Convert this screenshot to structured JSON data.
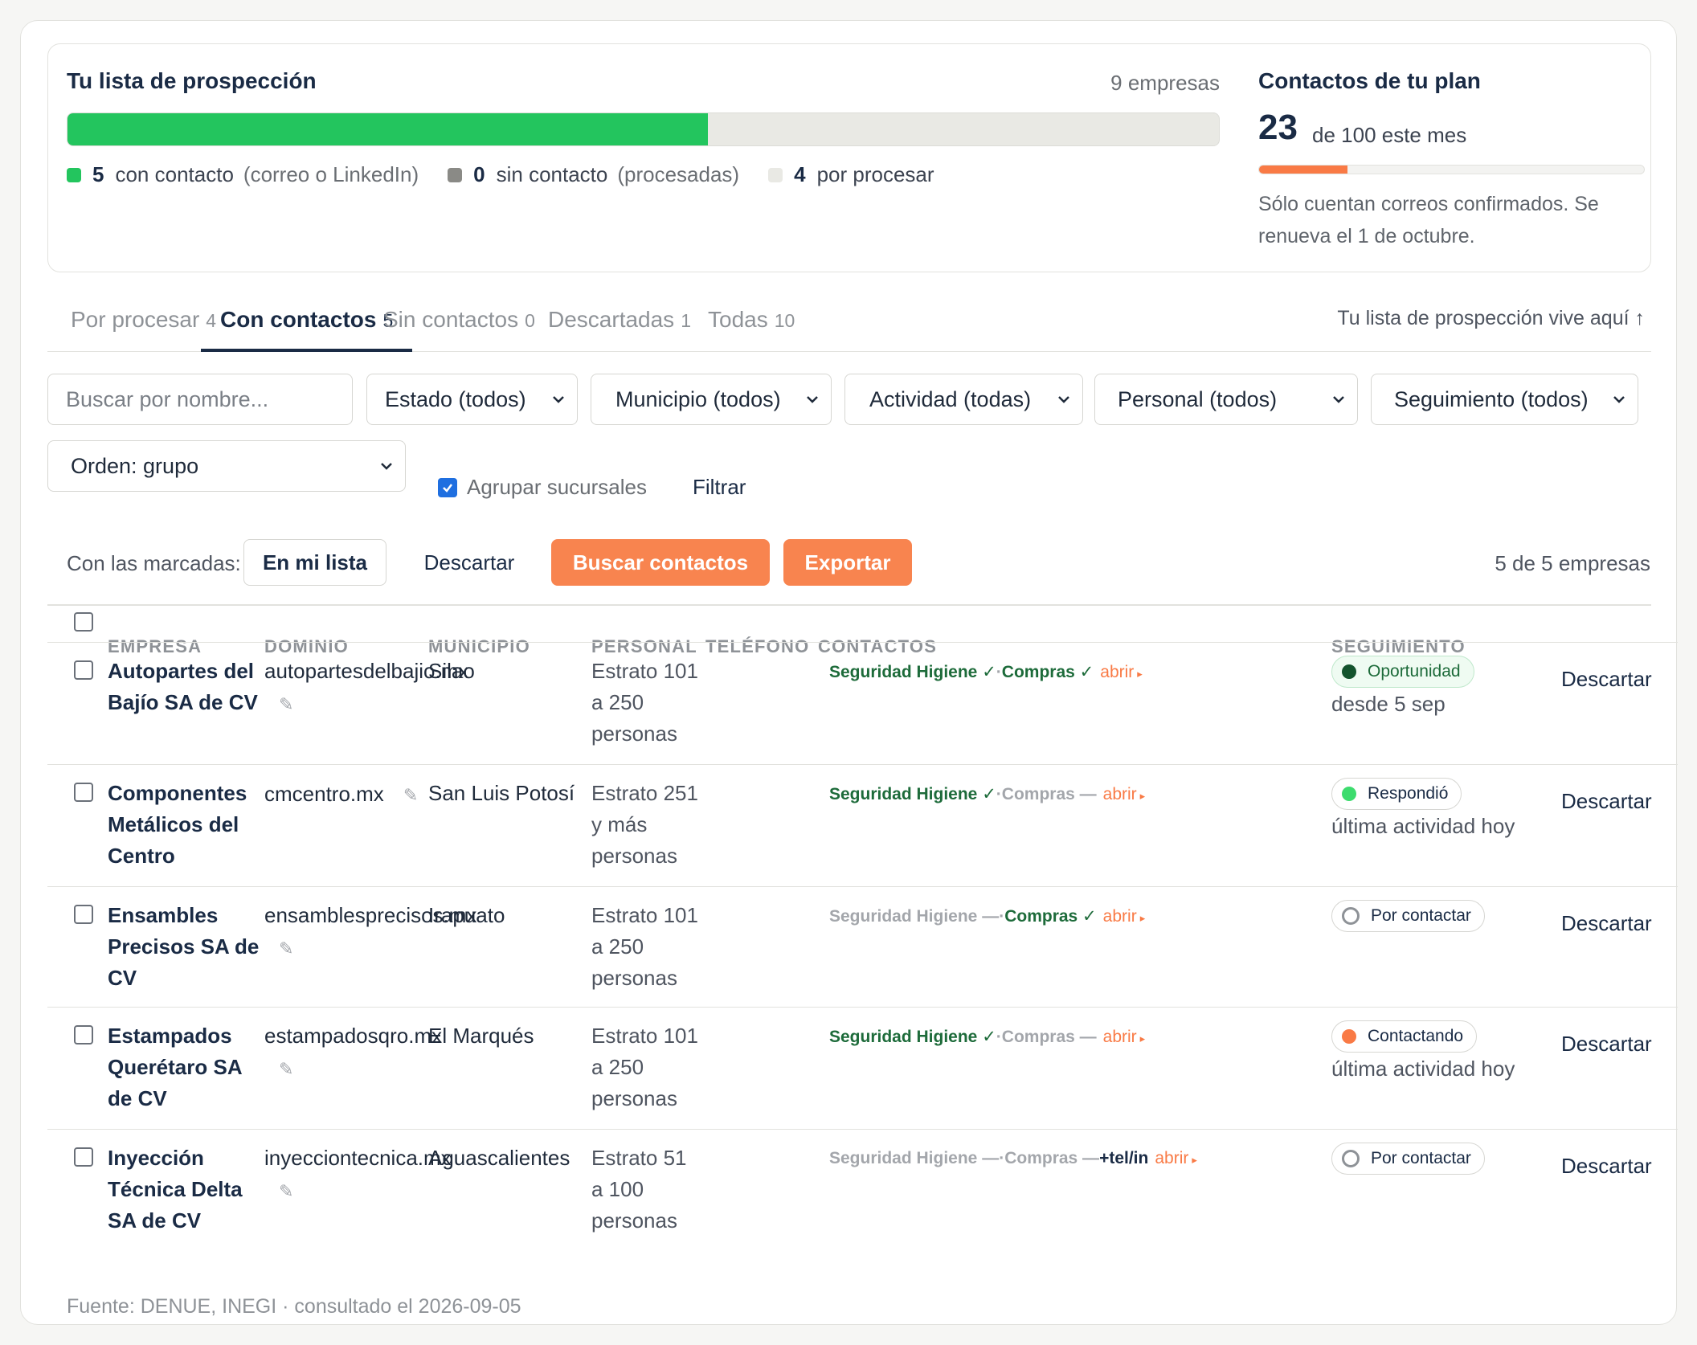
{
  "summary": {
    "title": "Tu lista de prospección",
    "company_count": "9 empresas",
    "progress_fraction": 0.556,
    "legend": [
      {
        "count": "5",
        "label": "con contacto",
        "note": "(correo o LinkedIn)",
        "color": "#23c55e"
      },
      {
        "count": "0",
        "label": "sin contacto",
        "note": "(procesadas)",
        "color": "#8a8a86"
      },
      {
        "count": "4",
        "label": "por procesar",
        "note": "",
        "color": "#e9e9e4"
      }
    ]
  },
  "plan": {
    "title": "Contactos de tu plan",
    "used": "23",
    "of_text": "de 100 este mes",
    "used_fraction": 0.23,
    "note": "Sólo cuentan correos confirmados. Se renueva el 1 de octubre."
  },
  "tabs": [
    {
      "label": "Por procesar",
      "count": "4"
    },
    {
      "label": "Con contactos",
      "count": "5"
    },
    {
      "label": "Sin contactos",
      "count": "0"
    },
    {
      "label": "Descartadas",
      "count": "1"
    },
    {
      "label": "Todas",
      "count": "10"
    }
  ],
  "tab_hint": "Tu lista de prospección vive aquí ↑",
  "filters": {
    "search_placeholder": "Buscar por nombre...",
    "estado": "Estado (todos)",
    "municipio": "Municipio (todos)",
    "actividad": "Actividad (todas)",
    "personal": "Personal (todos)",
    "seguimiento": "Seguimiento (todos)",
    "orden": "Orden: grupo",
    "agrupar_label": "Agrupar sucursales",
    "agrupar_checked": true,
    "filtrar": "Filtrar"
  },
  "bulk": {
    "label": "Con las marcadas:",
    "en_mi_lista": "En mi lista",
    "descartar": "Descartar",
    "buscar_contactos": "Buscar contactos",
    "exportar": "Exportar",
    "count": "5 de 5 empresas"
  },
  "table": {
    "headers": {
      "empresa": "EMPRESA",
      "dominio": "DOMINIO",
      "municipio": "MUNICIPIO",
      "personal": "PERSONAL",
      "telefono": "TELÉFONO",
      "contactos": "CONTACTOS",
      "seguimiento": "SEGUIMIENTO"
    },
    "rows": [
      {
        "company": "Autopartes del Bajío SA de CV",
        "domain": "autopartesdelbajio.mx",
        "municipio": "Silao",
        "personal": "Estrato 101 a 250 personas",
        "c1": "Seguridad Higiene ✓",
        "c1_ok": true,
        "c2": "Compras ✓",
        "c2_ok": true,
        "extra": "",
        "abrir": "abrir",
        "status": "Oportunidad",
        "status_color": "#14532d",
        "status_style": "green",
        "status_sub": "desde 5 sep",
        "action": "Descartar"
      },
      {
        "company": "Componentes Metálicos del Centro",
        "domain": "cmcentro.mx",
        "municipio": "San Luis Potosí",
        "personal": "Estrato 251 y más personas",
        "c1": "Seguridad Higiene ✓",
        "c1_ok": true,
        "c2": "Compras —",
        "c2_ok": false,
        "extra": "",
        "abrir": "abrir",
        "status": "Respondió",
        "status_color": "#3ddc6e",
        "status_style": "plain",
        "status_sub": "última actividad hoy",
        "action": "Descartar"
      },
      {
        "company": "Ensambles Precisos SA de CV",
        "domain": "ensamblesprecisos.mx",
        "municipio": "Irapuato",
        "personal": "Estrato 101 a 250 personas",
        "c1": "Seguridad Higiene —",
        "c1_ok": false,
        "c2": "Compras ✓",
        "c2_ok": true,
        "extra": "",
        "abrir": "abrir",
        "status": "Por contactar",
        "status_color": "ring",
        "status_style": "plain",
        "status_sub": "",
        "action": "Descartar"
      },
      {
        "company": "Estampados Querétaro SA de CV",
        "domain": "estampadosqro.mx",
        "municipio": "El Marqués",
        "personal": "Estrato 101 a 250 personas",
        "c1": "Seguridad Higiene ✓",
        "c1_ok": true,
        "c2": "Compras —",
        "c2_ok": false,
        "extra": "",
        "abrir": "abrir",
        "status": "Contactando",
        "status_color": "#f97a45",
        "status_style": "plain",
        "status_sub": "última actividad hoy",
        "action": "Descartar"
      },
      {
        "company": "Inyección Técnica Delta SA de CV",
        "domain": "inyecciontecnica.mx",
        "municipio": "Aguascalientes",
        "personal": "Estrato 51 a 100 personas",
        "c1": "Seguridad Higiene —",
        "c1_ok": false,
        "c2": "Compras —",
        "c2_ok": false,
        "extra": "+tel/in",
        "abrir": "abrir",
        "status": "Por contactar",
        "status_color": "ring",
        "status_style": "plain",
        "status_sub": "",
        "action": "Descartar"
      }
    ]
  },
  "footer": "Fuente: DENUE, INEGI · consultado el 2026-09-05"
}
